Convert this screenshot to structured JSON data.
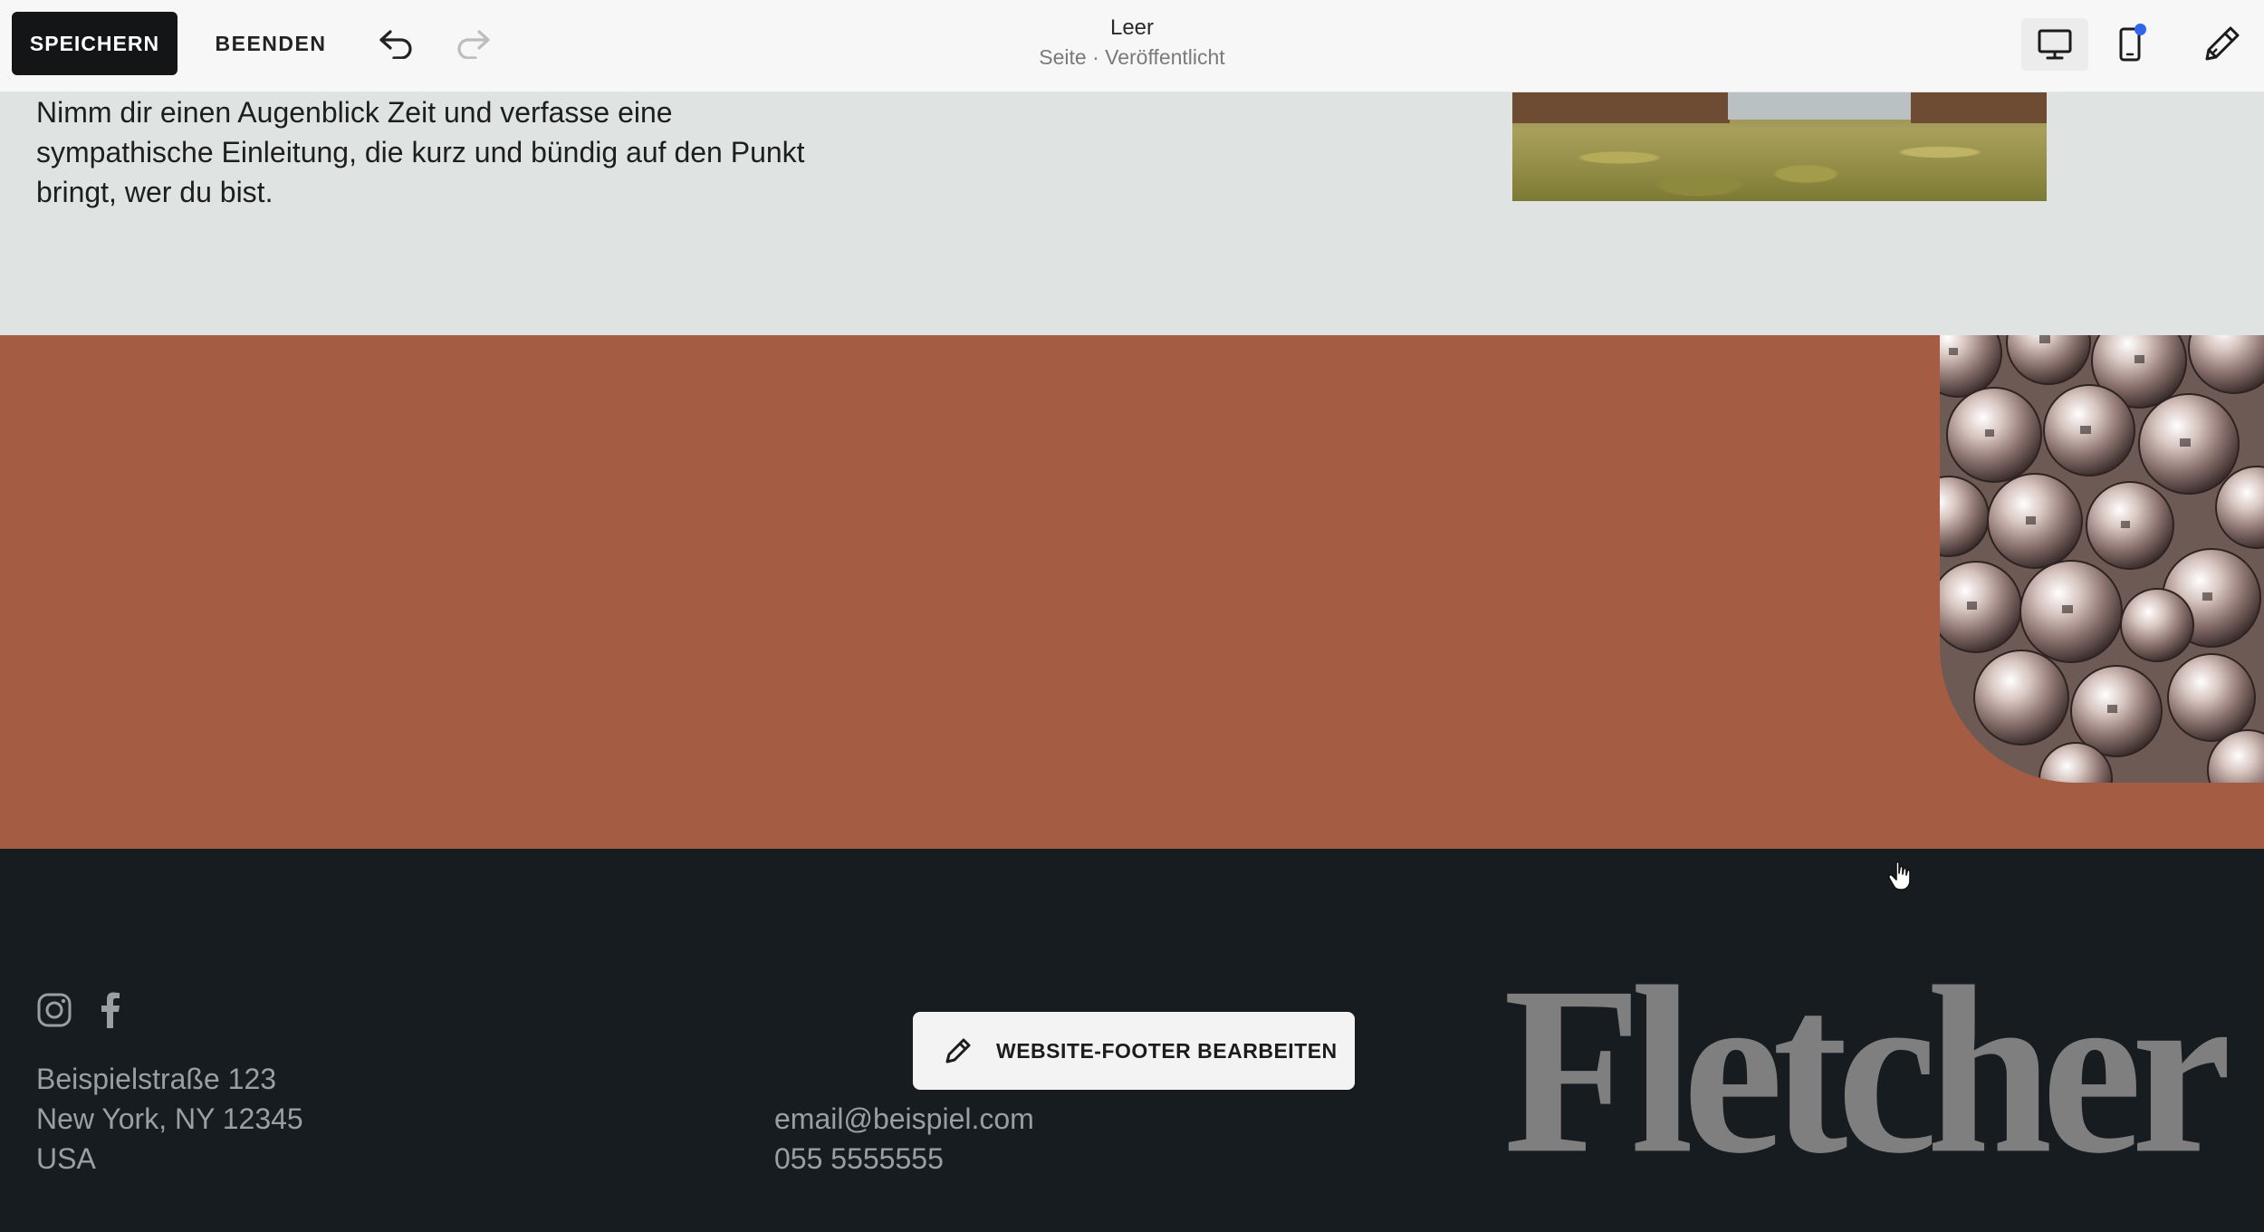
{
  "toolbar": {
    "save_label": "SPEICHERN",
    "exit_label": "BEENDEN",
    "undo_icon": "undo-icon",
    "redo_icon": "redo-icon",
    "page_name": "Leer",
    "page_status": "Seite · Veröffentlicht",
    "device_icons": [
      "desktop-icon",
      "mobile-icon"
    ],
    "design_icon": "paintbrush-icon",
    "mobile_indicator_color": "#2f66ec"
  },
  "intro": {
    "text": "Nimm dir einen Augenblick Zeit und verfasse eine sympathische Einleitung, die kurz und bündig auf den Punkt bringt, wer du bist."
  },
  "feature": {
    "background_color": "#a45c43"
  },
  "footer": {
    "social_icons": [
      "instagram-icon",
      "facebook-icon"
    ],
    "address": {
      "line1": "Beispielstraße 123",
      "line2": "New York, NY 12345",
      "line3": "USA"
    },
    "contact": {
      "email": "email@beispiel.com",
      "phone": "055 5555555"
    },
    "edit_button_label": "WEBSITE-FOOTER BEARBEITEN",
    "logo_text": "Fletcher",
    "background_color": "#171c20"
  }
}
